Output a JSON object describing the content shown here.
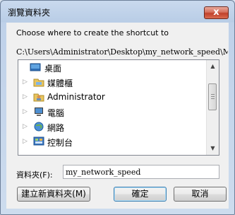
{
  "window": {
    "title": "瀏覽資料夾",
    "close_label": "x"
  },
  "prompt": "Choose where to create the shortcut to",
  "path": "C:\\Users\\Administrator\\Desktop\\my_network_speed\\My_Netw",
  "tree": {
    "items": [
      {
        "label": "桌面",
        "icon": "desktop-icon",
        "expandable": false
      },
      {
        "label": "媒體櫃",
        "icon": "library-icon",
        "expandable": true
      },
      {
        "label": "Administrator",
        "icon": "user-folder-icon",
        "expandable": true
      },
      {
        "label": "電腦",
        "icon": "computer-icon",
        "expandable": true
      },
      {
        "label": "網路",
        "icon": "network-icon",
        "expandable": true
      },
      {
        "label": "控制台",
        "icon": "control-panel-icon",
        "expandable": true
      }
    ]
  },
  "folder": {
    "label": "資料夾(F):",
    "value": "my_network_speed"
  },
  "buttons": {
    "new_folder": "建立新資料夾(M)",
    "ok": "確定",
    "cancel": "取消"
  }
}
